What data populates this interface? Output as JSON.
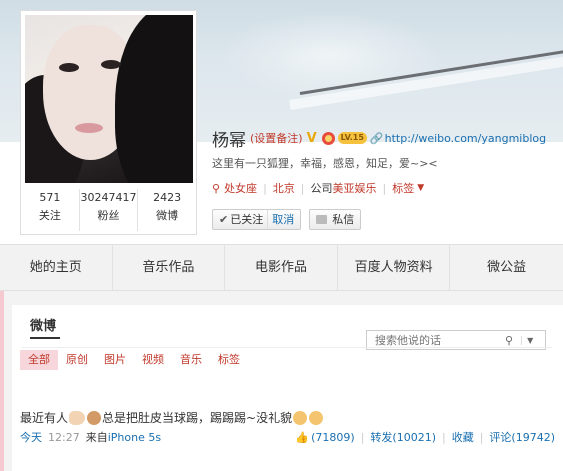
{
  "profile": {
    "name": "杨幂",
    "remark_link": "(设置备注)",
    "level_badge": "LV.15",
    "url": "http://weibo.com/yangmiblog",
    "bio": "这里有一只狐狸，幸福，感恩，知足，爱~><",
    "zodiac": "处女座",
    "city": "北京",
    "company_prefix": "公司",
    "company": "美亚娱乐",
    "tags_label": "标签",
    "followed_label": "已关注",
    "cancel_label": "取消",
    "message_label": "私信"
  },
  "stats": [
    {
      "value": "571",
      "label": "关注"
    },
    {
      "value": "30247417",
      "label": "粉丝"
    },
    {
      "value": "2423",
      "label": "微博"
    }
  ],
  "tabs": [
    "她的主页",
    "音乐作品",
    "电影作品",
    "百度人物资料",
    "微公益"
  ],
  "feed": {
    "title": "微博",
    "search_placeholder": "搜索他说的话",
    "filters": [
      "全部",
      "原创",
      "图片",
      "视频",
      "音乐",
      "标签"
    ],
    "post": {
      "text_1": "最近有人",
      "text_2": "总是把肚皮当球踢，踢踢踢~没礼貌",
      "time": "今天",
      "clock": "12:27",
      "from_label": "来自",
      "device": "iPhone 5s",
      "likes": "(71809)",
      "repost": "转发(10021)",
      "favorite": "收藏",
      "comment": "评论(19742)"
    }
  },
  "colors": {
    "accent_red": "#c0392b",
    "link_blue": "#1a6fb0",
    "filter_active_bg": "#f8d7dc"
  }
}
